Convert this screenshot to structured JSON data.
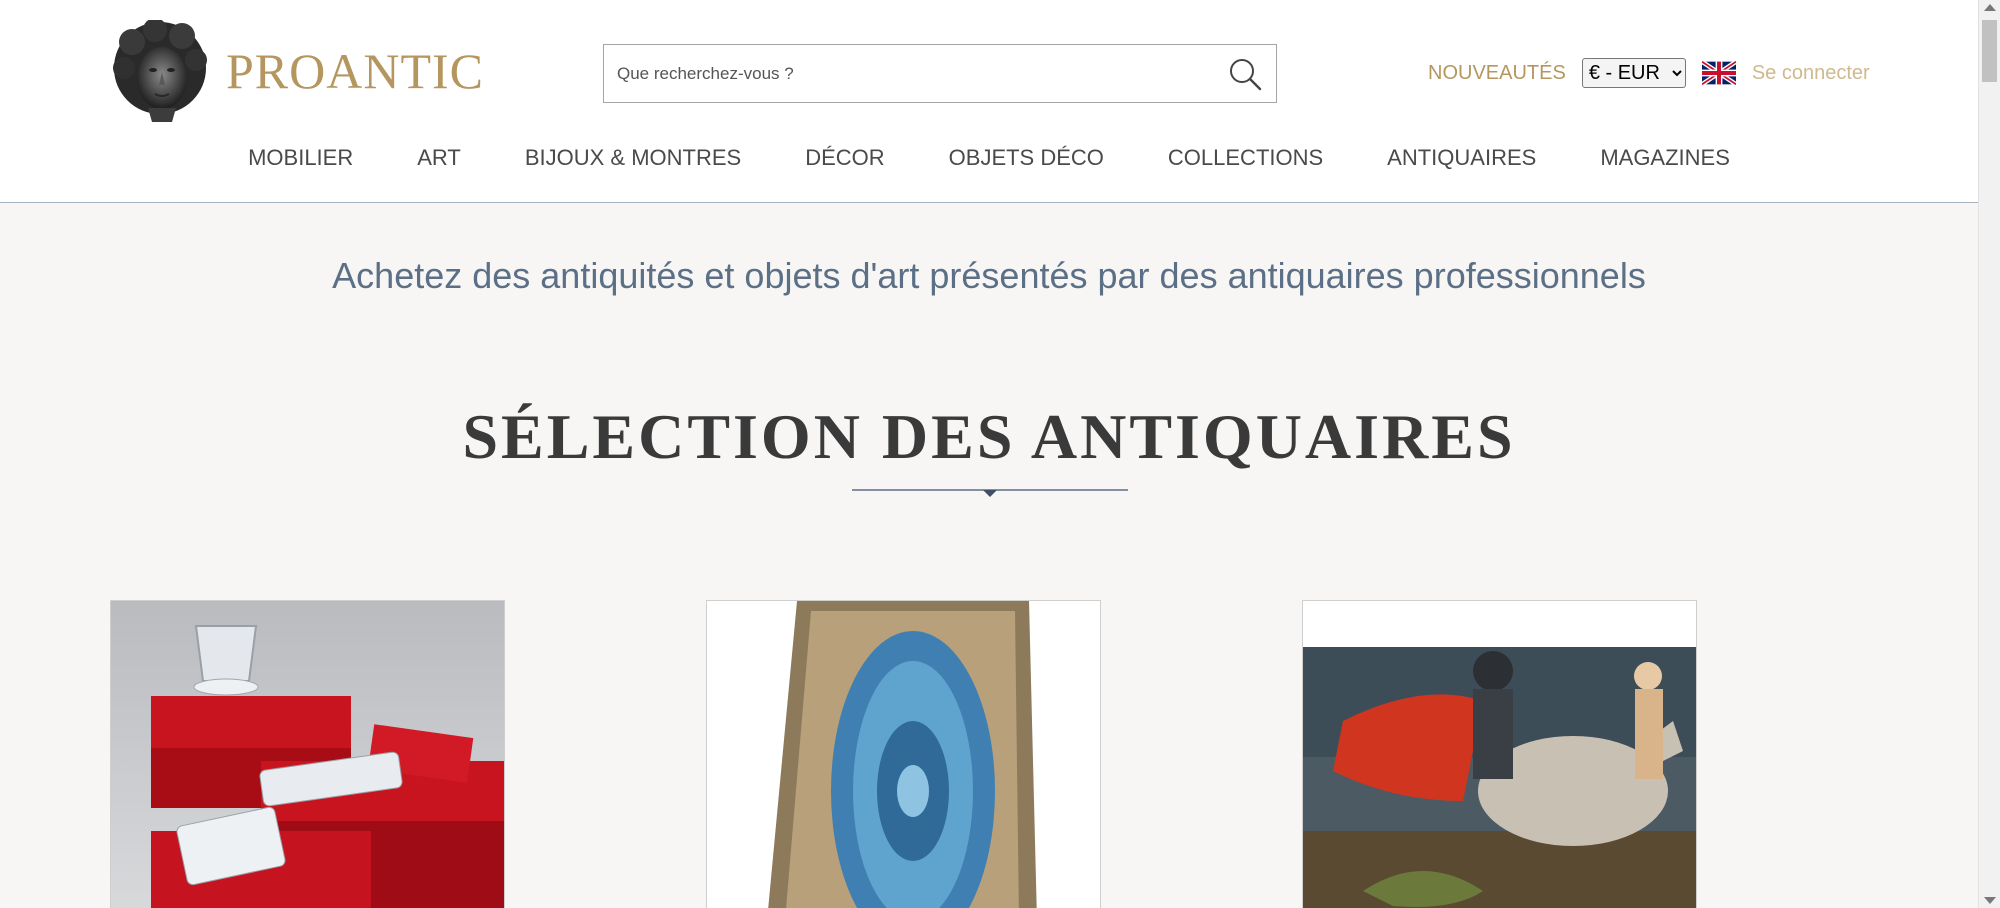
{
  "header": {
    "logo_text": "PROANTIC",
    "search": {
      "placeholder": "Que recherchez-vous ?",
      "value": ""
    },
    "nouveautes": "NOUVEAUTÉS",
    "currency": {
      "selected": "€ - EUR"
    },
    "language_flag": "uk-flag-icon",
    "login": "Se connecter"
  },
  "nav": {
    "items": [
      {
        "label": "MOBILIER"
      },
      {
        "label": "ART"
      },
      {
        "label": "BIJOUX & MONTRES"
      },
      {
        "label": "DÉCOR"
      },
      {
        "label": "OBJETS DÉCO"
      },
      {
        "label": "COLLECTIONS"
      },
      {
        "label": "ANTIQUAIRES"
      },
      {
        "label": "MAGAZINES"
      }
    ]
  },
  "main": {
    "tagline": "Achetez des antiquités et objets d'art présentés par des antiquaires professionnels",
    "section_title": "SÉLECTION DES ANTIQUAIRES"
  },
  "colors": {
    "brand_gold": "#b5965f",
    "tagline_blue": "#5b6f86",
    "background": "#f7f6f4"
  }
}
